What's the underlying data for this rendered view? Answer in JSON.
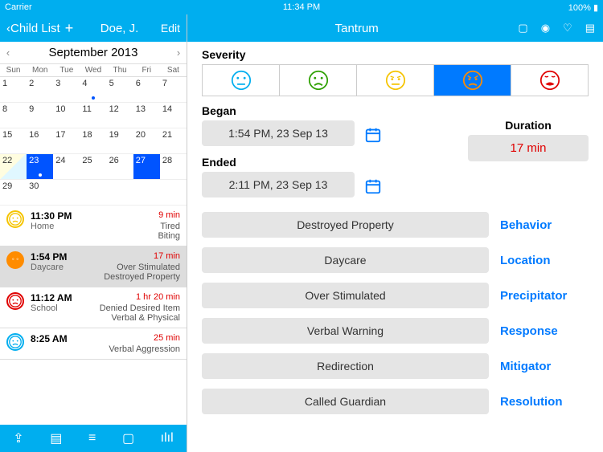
{
  "status": {
    "carrier": "Carrier",
    "wifi": "●",
    "time": "11:34 PM",
    "battery": "100%"
  },
  "left": {
    "back": "Child List",
    "name": "Doe, J.",
    "edit": "Edit",
    "month": "September 2013",
    "dow": [
      "Sun",
      "Mon",
      "Tue",
      "Wed",
      "Thu",
      "Fri",
      "Sat"
    ],
    "weeks": [
      [
        1,
        2,
        3,
        4,
        5,
        6,
        7
      ],
      [
        8,
        9,
        10,
        11,
        12,
        13,
        14
      ],
      [
        15,
        16,
        17,
        18,
        19,
        20,
        21
      ],
      [
        22,
        23,
        24,
        25,
        26,
        27,
        28
      ],
      [
        29,
        30,
        "",
        "",
        "",
        "",
        ""
      ]
    ],
    "events": [
      {
        "time": "11:30 PM",
        "loc": "Home",
        "dur": "9 min",
        "tag1": "Tired",
        "tag2": "Biting",
        "color": "yellow"
      },
      {
        "time": "1:54 PM",
        "loc": "Daycare",
        "dur": "17 min",
        "tag1": "Over Stimulated",
        "tag2": "Destroyed Property",
        "color": "orange"
      },
      {
        "time": "11:12 AM",
        "loc": "School",
        "dur": "1 hr 20 min",
        "tag1": "Denied Desired Item",
        "tag2": "Verbal & Physical",
        "color": "red"
      },
      {
        "time": "8:25 AM",
        "loc": "",
        "dur": "25 min",
        "tag1": "",
        "tag2": "Verbal Aggression",
        "color": "blue"
      }
    ]
  },
  "right": {
    "title": "Tantrum",
    "severity_label": "Severity",
    "began_label": "Began",
    "began": "1:54 PM, 23 Sep 13",
    "ended_label": "Ended",
    "ended": "2:11 PM, 23 Sep 13",
    "duration_label": "Duration",
    "duration": "17 min",
    "cats": [
      {
        "val": "Destroyed Property",
        "lbl": "Behavior"
      },
      {
        "val": "Daycare",
        "lbl": "Location"
      },
      {
        "val": "Over Stimulated",
        "lbl": "Precipitator"
      },
      {
        "val": "Verbal Warning",
        "lbl": "Response"
      },
      {
        "val": "Redirection",
        "lbl": "Mitigator"
      },
      {
        "val": "Called Guardian",
        "lbl": "Resolution"
      }
    ]
  }
}
